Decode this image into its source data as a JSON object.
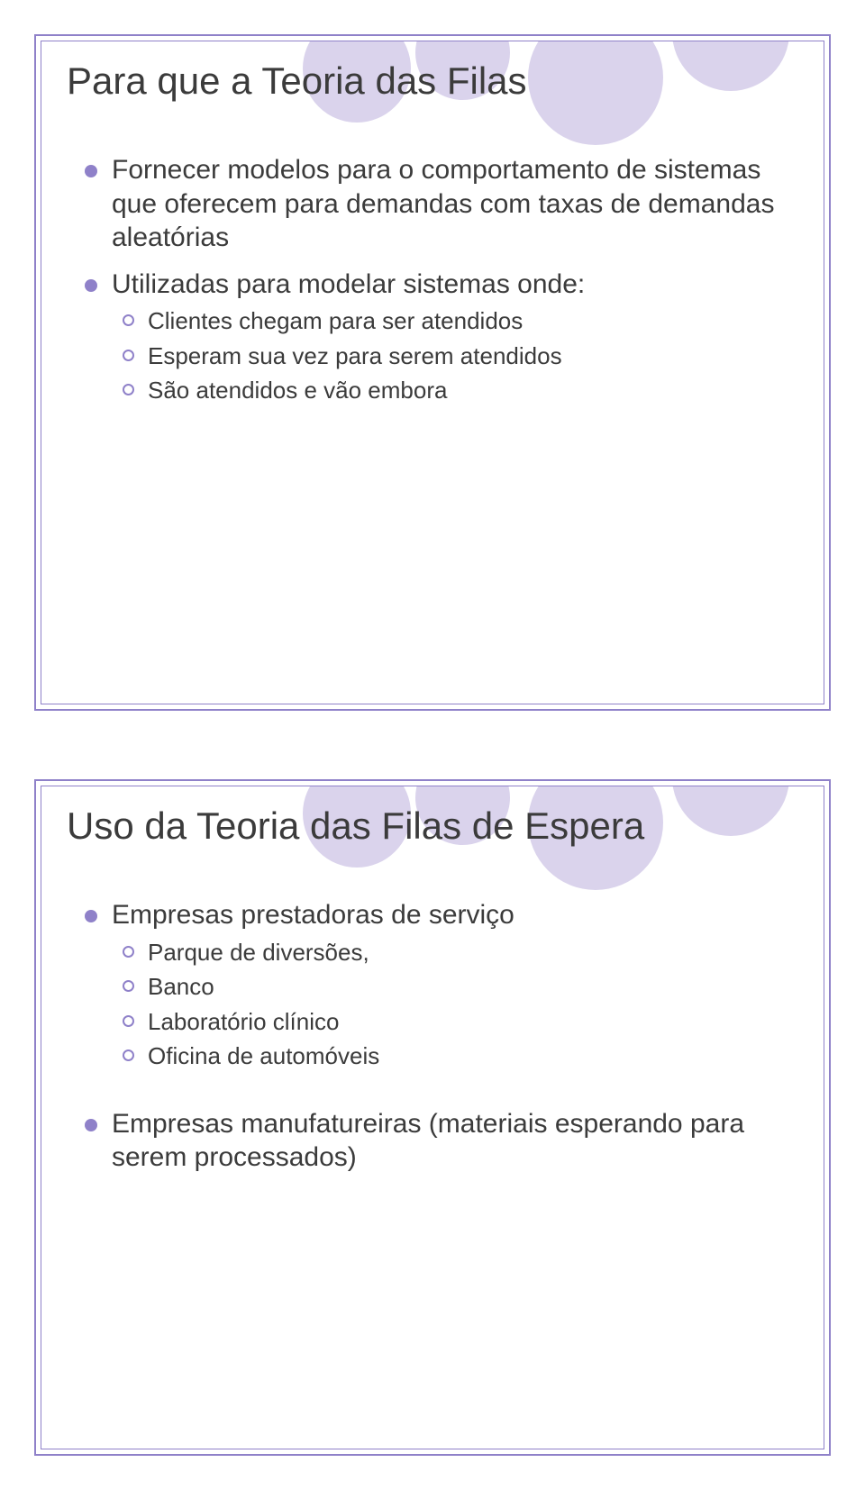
{
  "slides": [
    {
      "title": "Para que a Teoria das Filas",
      "bullets": [
        {
          "text": "Fornecer modelos para o comportamento de sistemas que oferecem para demandas com taxas de demandas aleatórias",
          "sub": []
        },
        {
          "text": "Utilizadas para modelar sistemas onde:",
          "sub": [
            "Clientes chegam para ser atendidos",
            "Esperam sua vez para serem atendidos",
            "São atendidos e vão embora"
          ]
        }
      ]
    },
    {
      "title": "Uso da Teoria das Filas de Espera",
      "bullets": [
        {
          "text": "Empresas prestadoras de serviço",
          "sub": [
            "Parque de diversões,",
            "Banco",
            "Laboratório clínico",
            "Oficina de automóveis"
          ]
        },
        {
          "text": "Empresas manufatureiras (materiais esperando para serem processados)",
          "sub": []
        }
      ]
    }
  ]
}
